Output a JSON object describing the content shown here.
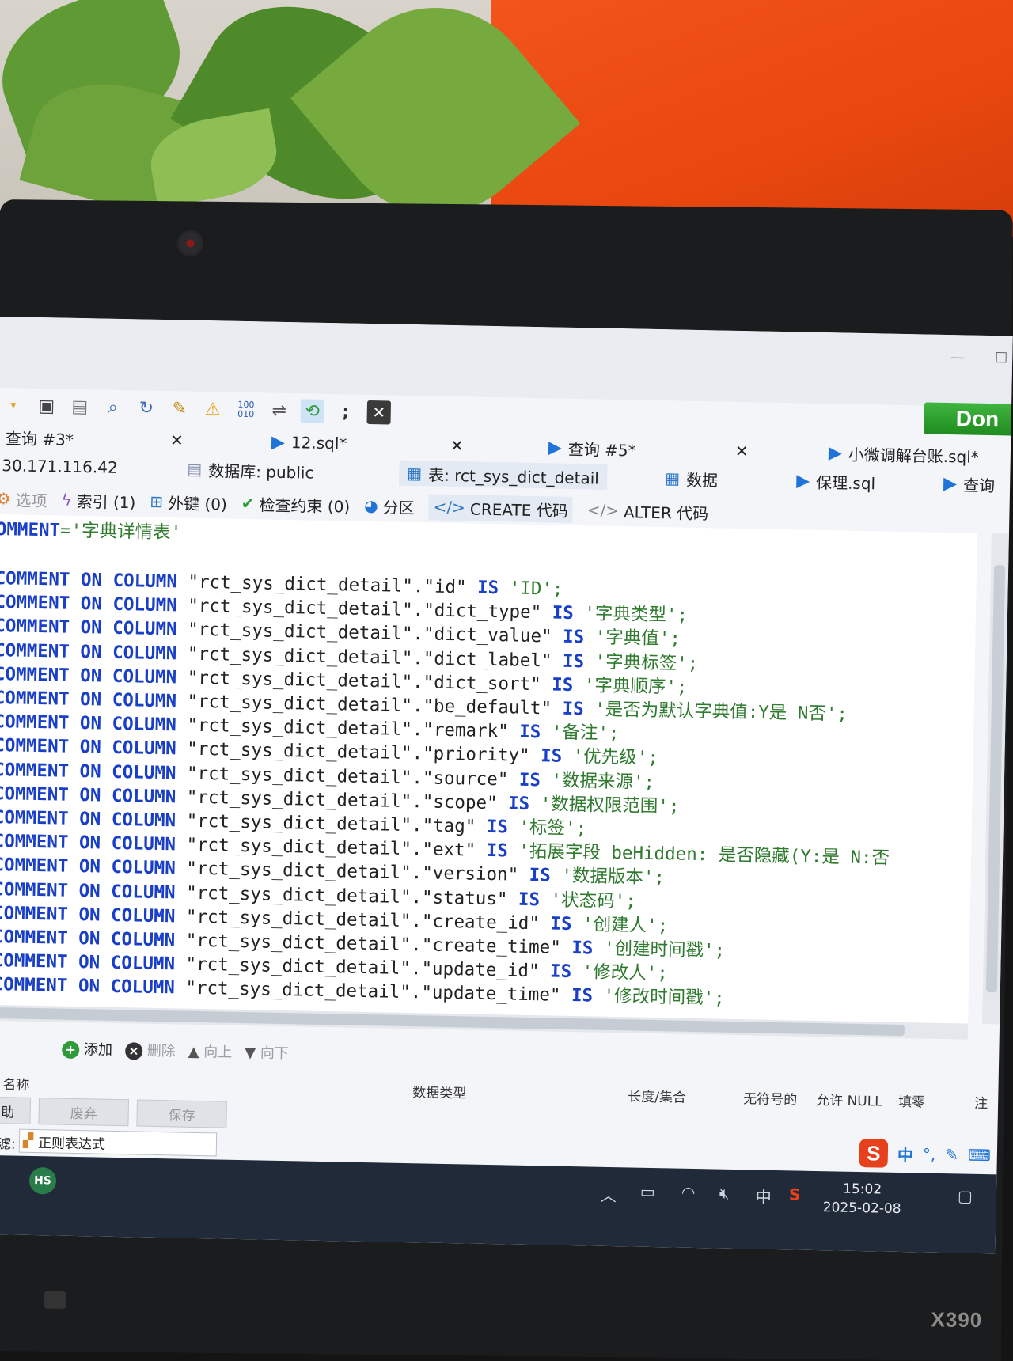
{
  "toolbar": {
    "done_label": "Don"
  },
  "tabs_row1": [
    {
      "label": "查询 #3*"
    },
    {
      "label": "12.sql*"
    },
    {
      "label": "查询 #5*"
    },
    {
      "label": "小微调解台账.sql*"
    }
  ],
  "tabs_row2": [
    {
      "label": "30.171.116.42"
    },
    {
      "label": "数据库: public"
    },
    {
      "label": "表: rct_sys_dict_detail"
    },
    {
      "label": "数据"
    },
    {
      "label": "保理.sql"
    },
    {
      "label": "查询"
    }
  ],
  "subtabs": [
    {
      "label": "选项"
    },
    {
      "label": "索引 (1)"
    },
    {
      "label": "外键 (0)"
    },
    {
      "label": "检查约束 (0)"
    },
    {
      "label": "分区"
    },
    {
      "label": "CREATE 代码"
    },
    {
      "label": "ALTER 代码"
    }
  ],
  "editor": {
    "first_line_kw": "OMMENT",
    "first_line_rest": "='字典详情表'",
    "line_kw1": "COMMENT",
    "line_kw2": "ON",
    "line_kw3": "COLUMN",
    "line_is": "IS",
    "table": "\"rct_sys_dict_detail\".",
    "lines": [
      {
        "column": "\"id\"",
        "comment": "'ID';"
      },
      {
        "column": "\"dict_type\"",
        "comment": "'字典类型';"
      },
      {
        "column": "\"dict_value\"",
        "comment": "'字典值';"
      },
      {
        "column": "\"dict_label\"",
        "comment": "'字典标签';"
      },
      {
        "column": "\"dict_sort\"",
        "comment": "'字典顺序';"
      },
      {
        "column": "\"be_default\"",
        "comment": "'是否为默认字典值:Y是 N否';"
      },
      {
        "column": "\"remark\"",
        "comment": "'备注';"
      },
      {
        "column": "\"priority\"",
        "comment": "'优先级';"
      },
      {
        "column": "\"source\"",
        "comment": "'数据来源';"
      },
      {
        "column": "\"scope\"",
        "comment": "'数据权限范围';"
      },
      {
        "column": "\"tag\"",
        "comment": "'标签';"
      },
      {
        "column": "\"ext\"",
        "comment": "'拓展字段 beHidden: 是否隐藏(Y:是 N:否"
      },
      {
        "column": "\"version\"",
        "comment": "'数据版本';"
      },
      {
        "column": "\"status\"",
        "comment": "'状态码';"
      },
      {
        "column": "\"create_id\"",
        "comment": "'创建人';"
      },
      {
        "column": "\"create_time\"",
        "comment": "'创建时间戳';"
      },
      {
        "column": "\"update_id\"",
        "comment": "'修改人';"
      },
      {
        "column": "\"update_time\"",
        "comment": "'修改时间戳';"
      }
    ]
  },
  "fields_toolbar": {
    "add": "添加",
    "delete": "删除",
    "up": "向上",
    "down": "向下"
  },
  "fields_header": {
    "hash": "#",
    "name": "名称",
    "type": "数据类型",
    "length": "长度/集合",
    "unsigned": "无符号的",
    "allow_null": "允许 NULL",
    "zerofill": "填零",
    "comment": "注"
  },
  "row_actions": {
    "left": "助",
    "discard": "废弃",
    "save": "保存"
  },
  "filter": {
    "label": "过滤:",
    "placeholder": "正则表达式"
  },
  "taskbar": {
    "hs_badge": "HS",
    "ime_zh": "中",
    "time": "15:02",
    "date": "2025-02-08"
  },
  "ime_bar": {
    "logo": "S",
    "zh": "中"
  },
  "device": {
    "model": "X390"
  },
  "colors": {
    "keyword": "#1a3fc7",
    "string": "#2f7a2f",
    "accent": "#1f73d9",
    "done_green": "#2a9d2a",
    "wall_orange": "#ea4a12"
  }
}
